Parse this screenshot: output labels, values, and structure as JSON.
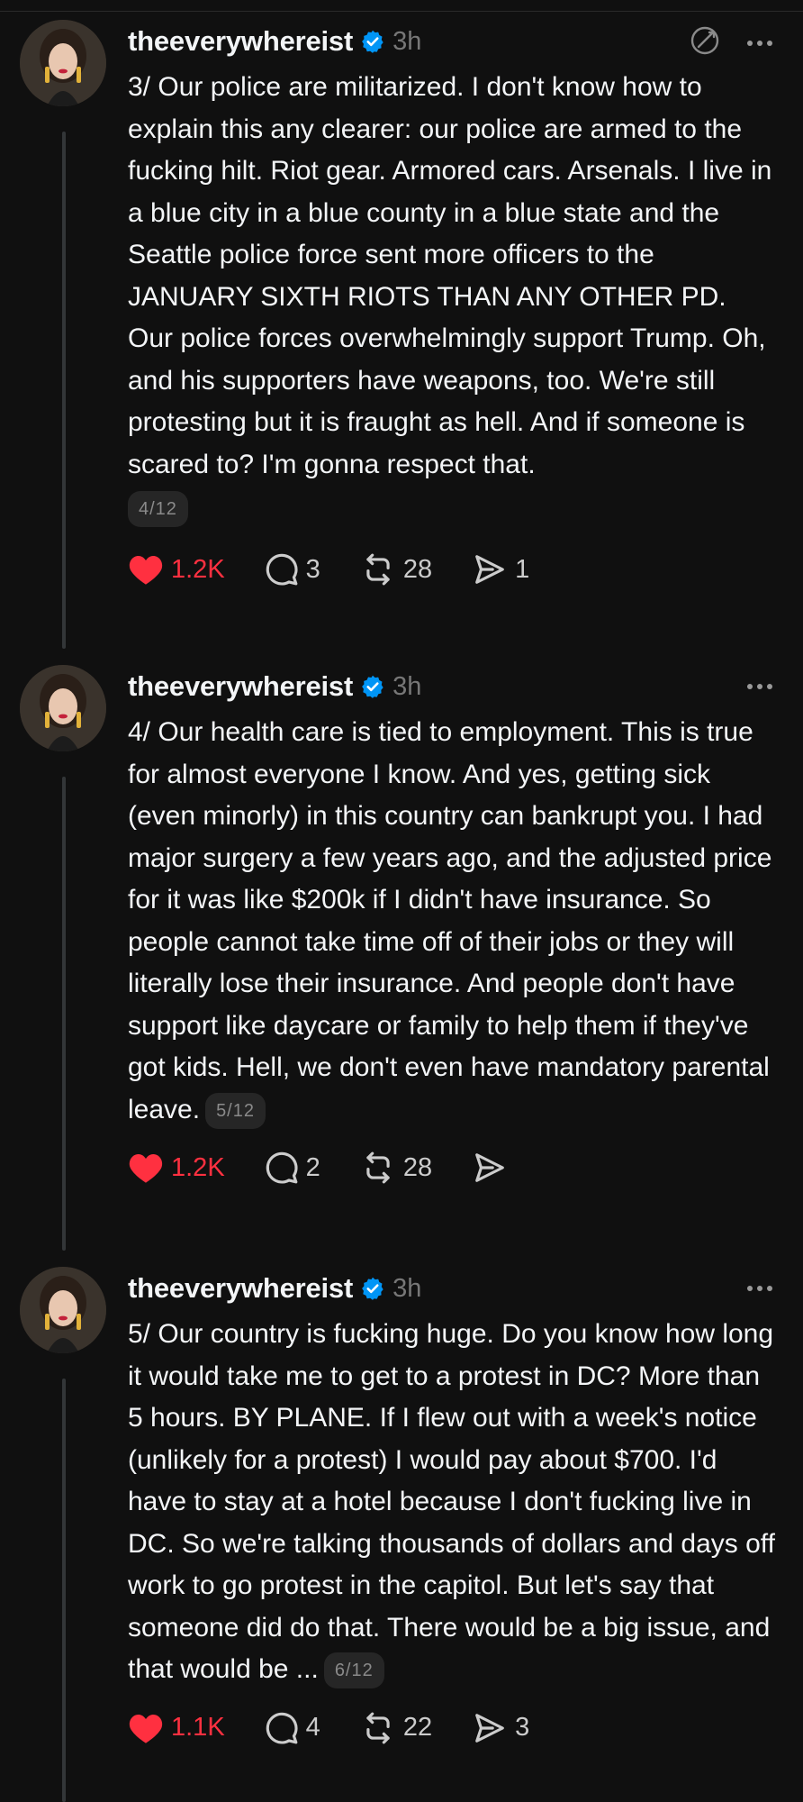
{
  "posts": [
    {
      "username": "theeverywhereist",
      "time": "3h",
      "text": "3/ Our police are militarized. I don't know how to explain this any clearer: our police are armed to the fucking hilt. Riot gear. Armored cars. Arsenals. I live in a blue city in a blue county in a blue state and the Seattle police force sent more officers to the JANUARY SIXTH RIOTS THAN ANY OTHER PD. Our police forces overwhelmingly support Trump. Oh, and his supporters have weapons, too. We're still protesting but it is fraught as hell. And if someone is scared to? I'm gonna respect that.",
      "tag": "4/12",
      "likes": "1.2K",
      "replies": "3",
      "reposts": "28",
      "shares": "1"
    },
    {
      "username": "theeverywhereist",
      "time": "3h",
      "text": "4/ Our health care is tied to employment. This is true for almost everyone I know. And yes, getting sick (even minorly) in this country can bankrupt you. I had major surgery a few years ago, and the adjusted price for it was like $200k if I didn't have insurance. So people cannot take time off of their jobs or they will literally lose their insurance. And people don't have support like daycare or family to help them if they've got kids. Hell, we don't even have mandatory parental leave.",
      "tag": "5/12",
      "likes": "1.2K",
      "replies": "2",
      "reposts": "28",
      "shares": ""
    },
    {
      "username": "theeverywhereist",
      "time": "3h",
      "text": "5/ Our country is fucking huge. Do you know how long it would take me to get to a protest in DC? More than 5 hours. BY PLANE. If I flew out with a week's notice (unlikely for a protest) I would pay about $700. I'd have to stay at a hotel because I don't fucking live in DC. So we're talking thousands of dollars and days off work to go protest in the capitol. But let's say that someone did do that. There would be a big issue, and that would be ...",
      "tag": "6/12",
      "likes": "1.1K",
      "replies": "4",
      "reposts": "22",
      "shares": "3"
    }
  ],
  "icons": {
    "verified": "verified-badge-icon",
    "like": "heart-icon",
    "reply": "comment-icon",
    "repost": "repost-icon",
    "share": "send-icon",
    "more": "more-icon",
    "translate": "translate-icon"
  },
  "colors": {
    "background": "#101010",
    "text": "#f3f5f7",
    "muted": "#777777",
    "like": "#ff3040",
    "verified": "#0095f6"
  }
}
